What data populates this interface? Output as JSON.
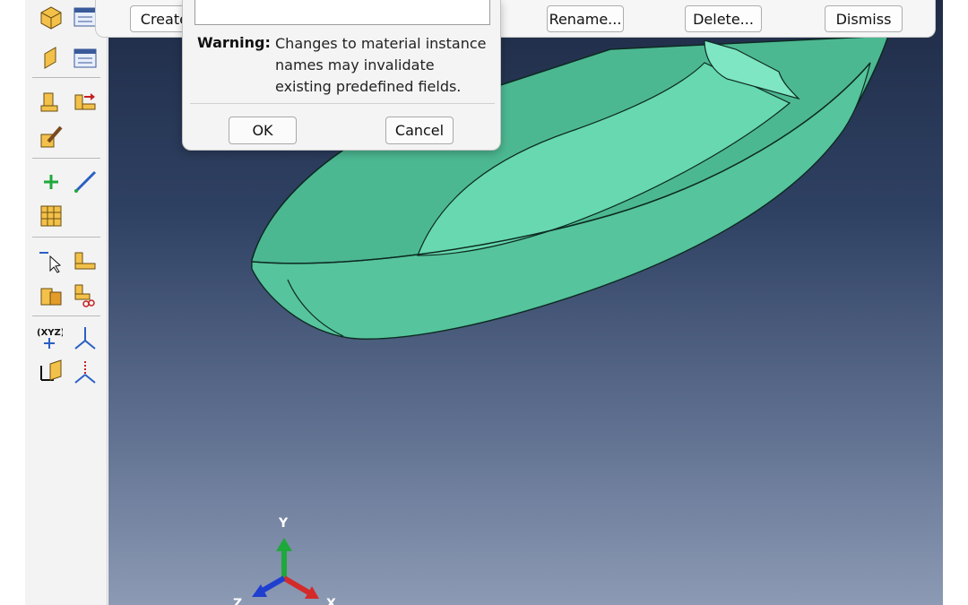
{
  "manager": {
    "create_label": "Create...",
    "rename_label": "Rename...",
    "delete_label": "Delete...",
    "dismiss_label": "Dismiss"
  },
  "rename_dialog": {
    "new_name": "",
    "warning_label": "Warning:",
    "warning_text": "Changes to material instance names may invalidate existing predefined fields.",
    "ok_label": "OK",
    "cancel_label": "Cancel"
  },
  "toolbox": {
    "icons": [
      "part-instance-icon",
      "assembly-list-icon",
      "instance-edit-icon",
      "instance-manager-icon",
      "translate-icon",
      "rotate-icon",
      "edit-feature-icon",
      "add-point-icon",
      "datum-line-icon",
      "pattern-icon",
      "select-icon",
      "merge-cut-icon",
      "boolean-icon",
      "suppress-icon",
      "datum-point-xyz-icon",
      "datum-axis-icon",
      "datum-csys-icon",
      "datum-plane-icon"
    ]
  },
  "triad": {
    "y_label": "Y",
    "x_label": "X",
    "z_label": "Z"
  },
  "colors": {
    "model_fill": "#5fcfa6",
    "model_shadow": "#3a9a7a",
    "viewport_top": "#1f2c47",
    "viewport_bottom": "#8c9ab4",
    "y_axis": "#1fa83c",
    "x_axis": "#d42a2a",
    "z_axis": "#1f3fcf"
  },
  "caption": {
    "text": ""
  }
}
